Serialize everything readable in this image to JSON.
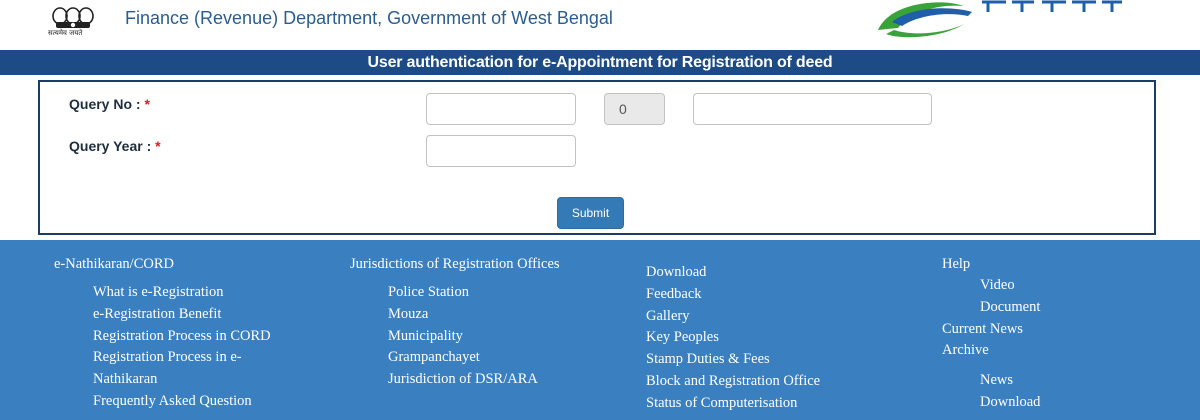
{
  "header": {
    "emblem_caption": "सत्यमेव जयते",
    "department": "Finance (Revenue) Department, Government of West Bengal"
  },
  "banner": {
    "title": "User authentication for e-Appointment for Registration of deed"
  },
  "form": {
    "query_no_label": "Query No : ",
    "query_year_label": "Query Year : ",
    "required_mark": "*",
    "query_no_part1": "",
    "query_no_part2": "0",
    "query_no_part3": "",
    "query_year": "",
    "submit_label": "Submit"
  },
  "footer": {
    "col1": {
      "heading": "e-Nathikaran/CORD",
      "items": [
        "What is e-Registration",
        "e-Registration Benefit",
        "Registration Process in CORD",
        "Registration Process in e-",
        "Nathikaran",
        "Frequently Asked Question"
      ]
    },
    "col2": {
      "heading": "Jurisdictions of Registration Offices",
      "items": [
        "Police Station",
        "Mouza",
        "Municipality",
        "Grampanchayet",
        "Jurisdiction of DSR/ARA"
      ]
    },
    "col3": {
      "items": [
        "Download",
        "Feedback",
        "Gallery",
        "Key Peoples",
        "Stamp Duties & Fees",
        "Block and Registration Office",
        "Status of Computerisation"
      ]
    },
    "col4": {
      "heading": "Help",
      "help_items": [
        "Video",
        "Document"
      ],
      "current_news": "Current News",
      "archive": "Archive",
      "archive_items": [
        "News",
        "Download"
      ]
    }
  },
  "colors": {
    "banner": "#1c4b86",
    "footer": "#3a7fc0",
    "button": "#337ab7",
    "required": "#d9201f"
  }
}
